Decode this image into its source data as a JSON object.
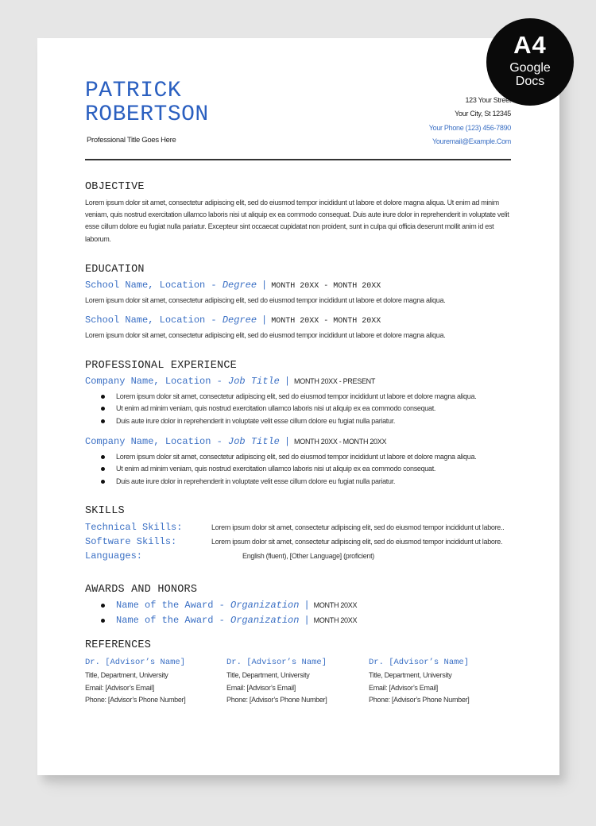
{
  "badge": {
    "size": "A4",
    "line1": "Google",
    "line2": "Docs"
  },
  "header": {
    "first_name": "PATRICK",
    "last_name": "ROBERTSON",
    "professional_title": "Professional Title Goes Here",
    "contact": {
      "street": "123 Your Street",
      "city": "Your City, St 12345",
      "phone": "Your Phone (123) 456-7890",
      "email": "Youremail@Example.Com"
    }
  },
  "objective": {
    "heading": "OBJECTIVE",
    "text": "Lorem ipsum dolor sit amet, consectetur adipiscing elit, sed do eiusmod tempor incididunt ut labore et dolore magna aliqua. Ut enim ad minim veniam, quis nostrud exercitation ullamco laboris nisi ut aliquip ex ea commodo consequat. Duis aute irure dolor in reprehenderit in voluptate velit esse cillum dolore eu fugiat nulla pariatur. Excepteur sint occaecat cupidatat non proident, sunt in culpa qui officia deserunt mollit anim id est laborum."
  },
  "education": {
    "heading": "EDUCATION",
    "entries": [
      {
        "school": "School Name, Location - ",
        "degree": "Degree",
        "separator": "|",
        "dates": "MONTH 20XX - MONTH 20XX",
        "description": "Lorem ipsum dolor sit amet, consectetur adipiscing elit, sed do eiusmod tempor incididunt ut labore et dolore magna aliqua."
      },
      {
        "school": "School Name, Location - ",
        "degree": "Degree",
        "separator": "|",
        "dates": "MONTH 20XX - MONTH 20XX",
        "description": "Lorem ipsum dolor sit amet, consectetur adipiscing elit, sed do eiusmod tempor incididunt ut labore et dolore magna aliqua."
      }
    ]
  },
  "experience": {
    "heading": "PROFESSIONAL EXPERIENCE",
    "entries": [
      {
        "company": "Company Name, Location - ",
        "job_title": "Job Title",
        "separator": "|",
        "dates": "MONTH 20XX - PRESENT",
        "bullets": [
          "Lorem ipsum dolor sit amet, consectetur adipiscing elit, sed do eiusmod tempor incididunt ut labore et dolore magna aliqua.",
          "Ut enim ad minim veniam, quis nostrud exercitation ullamco laboris nisi ut aliquip ex ea commodo consequat.",
          "Duis aute irure dolor in reprehenderit in voluptate velit esse cillum dolore eu fugiat nulla pariatur."
        ]
      },
      {
        "company": "Company Name, Location - ",
        "job_title": "Job Title",
        "separator": "|",
        "dates": "MONTH 20XX - MONTH 20XX",
        "bullets": [
          "Lorem ipsum dolor sit amet, consectetur adipiscing elit, sed do eiusmod tempor incididunt ut labore et dolore magna aliqua.",
          "Ut enim ad minim veniam, quis nostrud exercitation ullamco laboris nisi ut aliquip ex ea commodo consequat.",
          "Duis aute irure dolor in reprehenderit in voluptate velit esse cillum dolore eu fugiat nulla pariatur."
        ]
      }
    ]
  },
  "skills": {
    "heading": "SKILLS",
    "rows": [
      {
        "label": "Technical Skills:",
        "value": "Lorem ipsum dolor sit amet, consectetur adipiscing elit, sed do eiusmod tempor incididunt ut labore.."
      },
      {
        "label": "Software Skills:",
        "value": "Lorem ipsum dolor sit amet, consectetur adipiscing elit, sed do eiusmod tempor incididunt ut labore."
      },
      {
        "label": "Languages:",
        "value": "English (fluent), [Other Language] (proficient)"
      }
    ]
  },
  "awards": {
    "heading": "AWARDS AND HONORS",
    "items": [
      {
        "name": "Name of the Award - ",
        "organization": "Organization",
        "separator": "|",
        "date": "MONTH 20XX"
      },
      {
        "name": "Name of the Award - ",
        "organization": "Organization",
        "separator": "|",
        "date": "MONTH 20XX"
      }
    ]
  },
  "references": {
    "heading": "REFERENCES",
    "items": [
      {
        "name": "Dr. [Advisor’s Name]",
        "title": "Title, Department, University",
        "email": "Email: [Advisor’s Email]",
        "phone": "Phone: [Advisor’s Phone Number]"
      },
      {
        "name": "Dr. [Advisor’s Name]",
        "title": "Title, Department, University",
        "email": "Email: [Advisor’s Email]",
        "phone": "Phone: [Advisor’s Phone Number]"
      },
      {
        "name": "Dr. [Advisor’s Name]",
        "title": "Title, Department, University",
        "email": "Email: [Advisor’s Email]",
        "phone": "Phone: [Advisor’s Phone Number]"
      }
    ]
  }
}
